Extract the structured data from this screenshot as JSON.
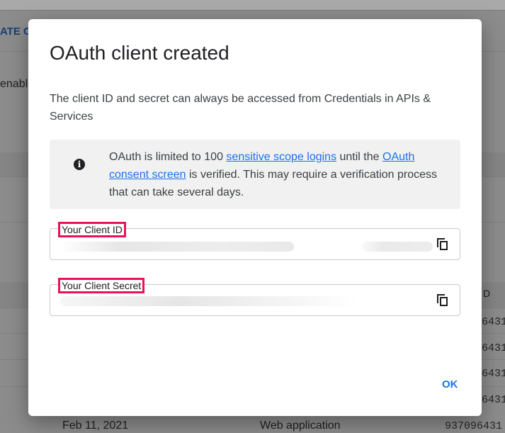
{
  "background": {
    "create_label": "ATE C",
    "enable_text": "enable",
    "col_header_partial": "D",
    "client_ids_partial": [
      "6431",
      "6431",
      "6431",
      "6431"
    ],
    "last_row": {
      "date": "Feb 11, 2021",
      "type": "Web application",
      "client_id": "937096431"
    }
  },
  "dialog": {
    "title": "OAuth client created",
    "description": "The client ID and secret can always be accessed from Credentials in APIs & Services",
    "info": {
      "icon": "info-icon",
      "text_1": "OAuth is limited to 100 ",
      "link_1": "sensitive scope logins",
      "text_2": " until the ",
      "link_2": "OAuth consent screen",
      "text_3": " is verified. This may require a verification process that can take several days."
    },
    "client_id_label": "Your Client ID",
    "client_secret_label": "Your Client Secret",
    "ok_label": "OK"
  },
  "colors": {
    "accent": "#1a73e8",
    "highlight": "#e8125c"
  }
}
